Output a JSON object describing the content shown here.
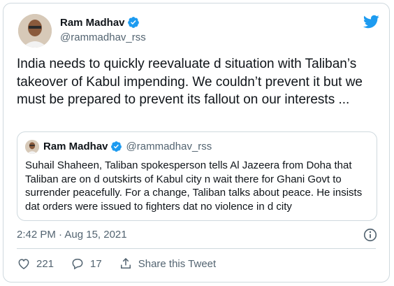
{
  "author": {
    "name": "Ram Madhav",
    "handle": "@rammadhav_rss"
  },
  "tweet": {
    "text": "India needs to quickly reevaluate d situation with Taliban’s takeover of Kabul impending. We couldn’t prevent it but we must be prepared to prevent its fallout on our interests ...",
    "timestamp": "2:42 PM · Aug 15, 2021"
  },
  "quoted_tweet": {
    "name": "Ram Madhav",
    "handle": "@rammadhav_rss",
    "text": "Suhail Shaheen, Taliban spokesperson tells Al Jazeera from Doha that Taliban are on d outskirts of Kabul city n wait there for Ghani Govt to surrender peacefully. For a change, Taliban talks about peace. He insists dat orders were issued to fighters dat no violence in d city"
  },
  "actions": {
    "likes": "221",
    "replies": "17",
    "share_label": "Share this Tweet"
  },
  "colors": {
    "twitter_blue": "#1d9bf0",
    "secondary_text": "#536471",
    "border": "#cfd9de"
  },
  "icons": [
    "verified-badge-icon",
    "twitter-bird-icon",
    "info-icon",
    "heart-icon",
    "reply-icon",
    "share-icon"
  ]
}
